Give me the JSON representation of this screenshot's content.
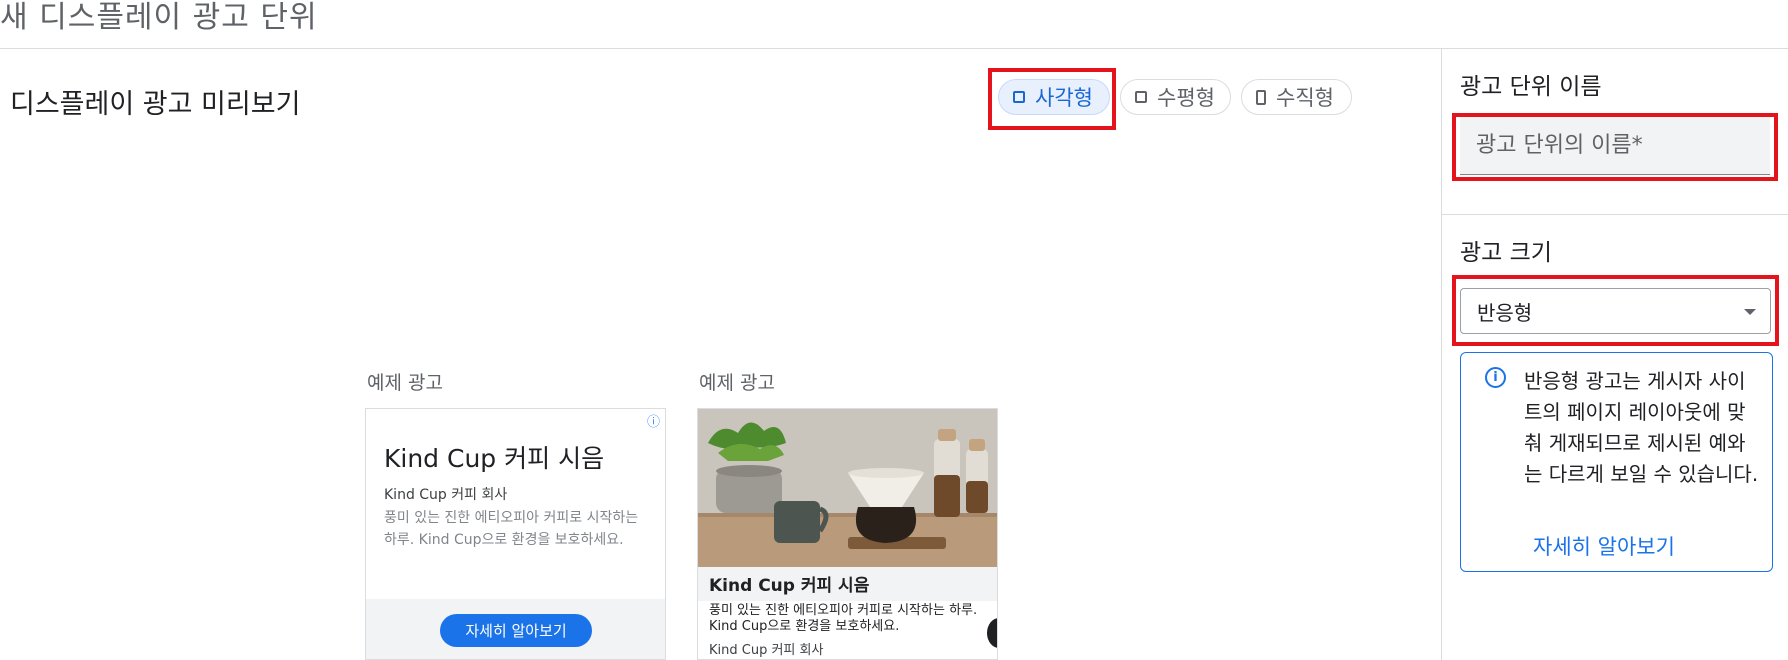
{
  "page": {
    "title": "새 디스플레이 광고 단위"
  },
  "preview": {
    "title": "디스플레이 광고 미리보기",
    "shape_options": [
      {
        "label": "사각형",
        "icon": "square-icon",
        "selected": true
      },
      {
        "label": "수평형",
        "icon": "horizontal-rectangle-icon",
        "selected": false
      },
      {
        "label": "수직형",
        "icon": "vertical-rectangle-icon",
        "selected": false
      }
    ],
    "samples": [
      {
        "label": "예제 광고",
        "info_icon": "ⓘ",
        "headline": "Kind Cup 커피 시음",
        "advertiser": "Kind Cup 커피 회사",
        "description": "풍미 있는 진한 에티오피아 커피로 시작하는 하루. Kind Cup으로 환경을 보호하세요.",
        "cta": "자세히 알아보기"
      },
      {
        "label": "예제 광고",
        "image": "coffee-photo",
        "headline": "Kind Cup 커피 시음",
        "description": "풍미 있는 진한 에티오피아 커피로 시작하는 하루. Kind Cup으로 환경을 보호하세요.",
        "advertiser": "Kind Cup 커피 회사"
      }
    ]
  },
  "settings": {
    "name_label": "광고 단위 이름",
    "name_placeholder": "광고 단위의 이름*",
    "size_label": "광고 크기",
    "size_value": "반응형",
    "info_icon": "i",
    "info_text": "반응형 광고는 게시자 사이트의 페이지 레이아웃에 맞춰 게재되므로 제시된 예와는 다르게 보일 수 있습니다.",
    "info_link": "자세히 알아보기"
  },
  "colors": {
    "accent": "#1a73e8",
    "highlight": "#e3141c",
    "selected_chip_bg": "#e8f0fe"
  }
}
